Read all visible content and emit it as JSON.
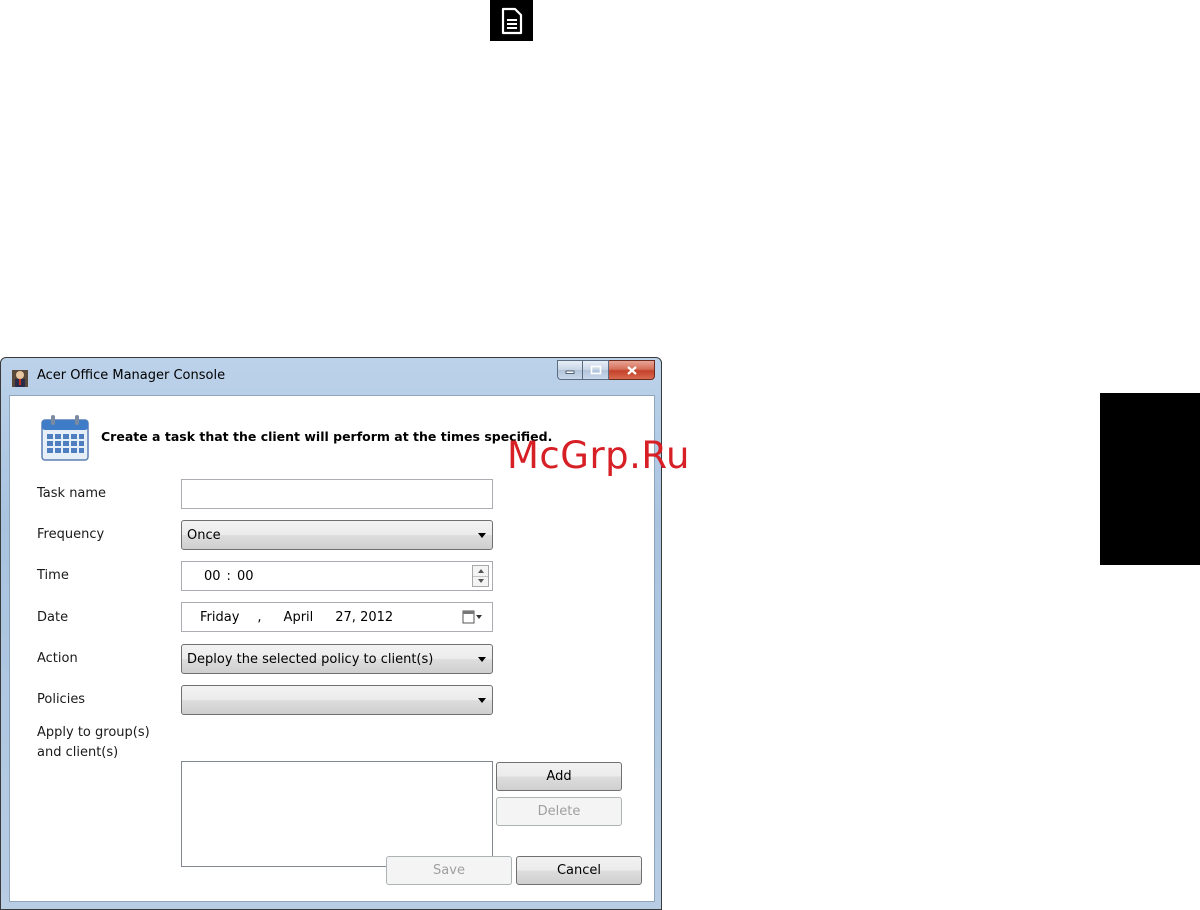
{
  "window": {
    "title": "Acer Office Manager Console"
  },
  "watermark": "McGrp.Ru",
  "header": {
    "text": "Create a task that the client will perform at the times specified."
  },
  "form": {
    "task_name": {
      "label": "Task name",
      "value": ""
    },
    "frequency": {
      "label": "Frequency",
      "value": "Once"
    },
    "time": {
      "label": "Time",
      "hour": "00",
      "separator": ":",
      "minute": "00"
    },
    "date": {
      "label": "Date",
      "weekday": "Friday",
      "comma": ",",
      "month": "April",
      "day_year": "27, 2012"
    },
    "action": {
      "label": "Action",
      "value": "Deploy the selected policy to client(s)"
    },
    "policies": {
      "label": "Policies",
      "value": ""
    },
    "apply_to": {
      "label_line1": "Apply to group(s)",
      "label_line2": "and client(s)"
    }
  },
  "buttons": {
    "add": "Add",
    "delete": "Delete",
    "save": "Save",
    "cancel": "Cancel"
  },
  "icons": {
    "top": "document-icon",
    "app": "acer-office-manager-icon",
    "header": "calendar-icon",
    "date_picker": "calendar-dropdown-icon"
  }
}
